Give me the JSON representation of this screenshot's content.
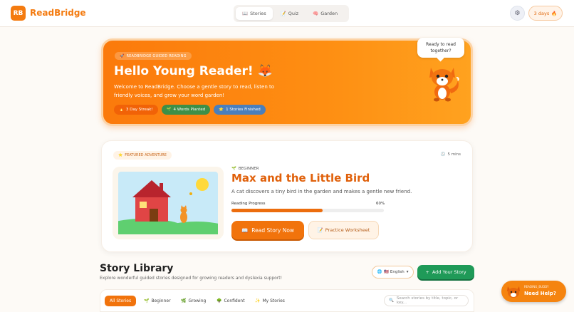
{
  "header": {
    "logo_initials": "RB",
    "app_name": "ReadBridge",
    "tabs": [
      {
        "icon": "📖",
        "label": "Stories",
        "active": true
      },
      {
        "icon": "📝",
        "label": "Quiz",
        "active": false
      },
      {
        "icon": "🧠",
        "label": "Garden",
        "active": false
      }
    ],
    "settings_icon": "⚙",
    "streak_label": "3 days",
    "streak_icon": "🔥"
  },
  "hero": {
    "kicker_icon": "🚀",
    "kicker": "READBRIDGE GUIDED READING",
    "title": "Hello Young Reader! 🦊",
    "description": "Welcome to ReadBridge. Choose a gentle story to read, listen to friendly voices, and grow your word garden!",
    "chips": [
      {
        "icon": "🔥",
        "label": "3 Day Streak!"
      },
      {
        "icon": "🌱",
        "label": "4 Words Planted"
      },
      {
        "icon": "⭐",
        "label": "1 Stories Finished"
      }
    ],
    "bubble": "Ready to read together?"
  },
  "featured": {
    "badge_icon": "⭐",
    "badge": "FEATURED ADVENTURE",
    "time_icon": "🕒",
    "time": "5 mins",
    "level_icon": "🌱",
    "level": "BEGINNER",
    "title": "Max and the Little Bird",
    "description": "A cat discovers a tiny bird in the garden and makes a gentle new friend.",
    "progress_label": "Reading Progress",
    "progress_text": "60%",
    "progress": 0.6,
    "read_icon": "📖",
    "read_label": "Read Story Now",
    "worksheet_icon": "📝",
    "worksheet_label": "Practice Worksheet"
  },
  "library": {
    "title": "Story Library",
    "subtitle": "Explore wonderful guided stories designed for growing readers and dyslexia support!",
    "language_icon": "🌐",
    "language_label": "🇺🇸 English",
    "language_chevron": "▾",
    "add_icon": "+",
    "add_label": "Add Your Story",
    "filters": [
      {
        "icon": "",
        "label": "All Stories",
        "active": true
      },
      {
        "icon": "🌱",
        "label": "Beginner",
        "active": false
      },
      {
        "icon": "🌿",
        "label": "Growing",
        "active": false
      },
      {
        "icon": "🌳",
        "label": "Confident",
        "active": false
      },
      {
        "icon": "✨",
        "label": "My Stories",
        "active": false
      }
    ],
    "search_icon": "🔍",
    "search_placeholder": "Search stories by title, topic, or key..."
  },
  "help": {
    "buddy": "READING_BUDDY",
    "label": "Need Help?"
  },
  "colors": {
    "accent": "#f1730c",
    "green": "#1f9a58",
    "blue": "#4a7fbc"
  }
}
